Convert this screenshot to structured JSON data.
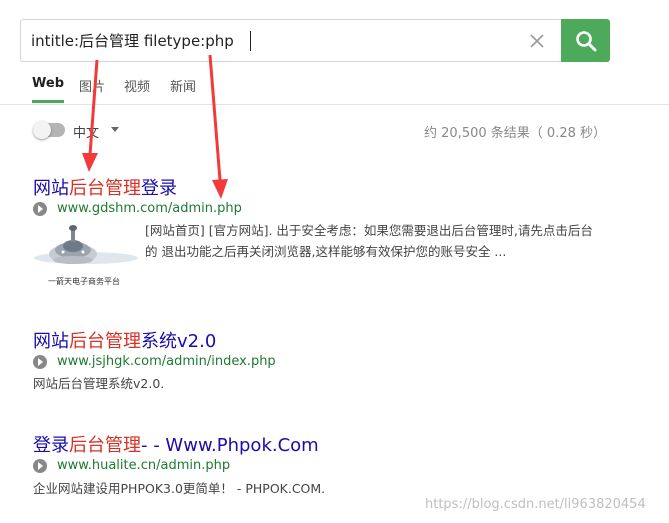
{
  "search": {
    "query": "intitle:后台管理 filetype:php",
    "clear_icon": "close-icon",
    "submit_icon": "search-icon",
    "accent_color": "#4caa5a"
  },
  "tabs": [
    {
      "label": "Web",
      "active": true
    },
    {
      "label": "图片",
      "active": false
    },
    {
      "label": "视频",
      "active": false
    },
    {
      "label": "新闻",
      "active": false
    }
  ],
  "filters": {
    "safe_toggle_on": false,
    "language": "中文",
    "stats": "约 20,500 条结果（ 0.28 秒）"
  },
  "results": [
    {
      "title_pre": "网站",
      "title_hl": "后台管理",
      "title_post": "登录",
      "url": "www.gdshm.com/admin.php",
      "snippet": "[网站首页] [官方网站]. 出于安全考虑：如果您需要退出后台管理时,请先点击后台的 退出功能之后再关闭浏览器,这样能够有效保护您的账号安全 ...",
      "thumb_caption": "一箭天电子商务平台"
    },
    {
      "title_pre": "网站",
      "title_hl": "后台管理",
      "title_post": "系统v2.0",
      "url": "www.jsjhgk.com/admin/index.php",
      "snippet": "网站后台管理系统v2.0."
    },
    {
      "title_pre": "登录",
      "title_hl": "后台管理",
      "title_post": "- - Www.Phpok.Com",
      "url": "www.hualite.cn/admin.php",
      "snippet": "企业网站建设用PHPOK3.0更简单！ - PHPOK.COM."
    }
  ],
  "watermark": "https://blog.csdn.net/li963820454",
  "annotation_color": "#f23a3a"
}
